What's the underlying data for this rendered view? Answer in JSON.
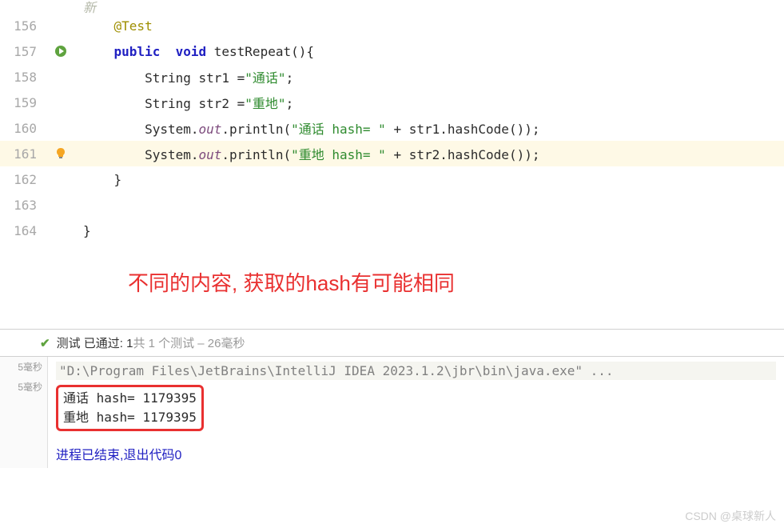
{
  "code": {
    "lines": [
      {
        "num": "156",
        "content_html": "    <span class='kw-annotation'>@Test</span>"
      },
      {
        "num": "157",
        "icon": "run",
        "content_html": "    <span class='kw-blue'>public</span>  <span class='kw-blue'>void</span> <span class='kw-normal'>testRepeat(){</span>"
      },
      {
        "num": "158",
        "content_html": "        <span class='kw-normal'>String str1 =</span><span class='kw-string'>\"通话\"</span><span class='kw-normal'>;</span>"
      },
      {
        "num": "159",
        "content_html": "        <span class='kw-normal'>String str2 =</span><span class='kw-string'>\"重地\"</span><span class='kw-normal'>;</span>"
      },
      {
        "num": "160",
        "content_html": "        <span class='kw-normal'>System.</span><span class='kw-italic'>out</span><span class='kw-normal'>.println(</span><span class='kw-string'>\"通话 hash= \"</span><span class='kw-normal'> + str1.hashCode());</span>"
      },
      {
        "num": "161",
        "icon": "bulb",
        "highlighted": true,
        "content_html": "        <span class='kw-normal'>System.</span><span class='kw-italic'>out</span><span class='kw-normal'>.println(</span><span class='kw-string'>\"重地 hash= \"</span><span class='kw-normal'> + str2.hashCode());</span>"
      },
      {
        "num": "162",
        "content_html": "    <span class='kw-normal'>}</span>"
      },
      {
        "num": "163",
        "content_html": ""
      },
      {
        "num": "164",
        "content_html": "<span class='kw-normal'>}</span>"
      }
    ],
    "partial_top": "新"
  },
  "annotation": {
    "text": "不同的内容, 获取的hash有可能相同"
  },
  "test_status": {
    "prefix": "测试 已通过: 1",
    "middle": "共 1 个测试",
    "suffix": " – 26毫秒"
  },
  "console": {
    "left_items": [
      "5毫秒",
      "5毫秒"
    ],
    "cmd": "\"D:\\Program Files\\JetBrains\\IntelliJ IDEA 2023.1.2\\jbr\\bin\\java.exe\" ...",
    "outputs": [
      "通话 hash= 1179395",
      "重地 hash= 1179395"
    ],
    "exit": "进程已结束,退出代码0"
  },
  "watermark": "CSDN @桌球新人"
}
